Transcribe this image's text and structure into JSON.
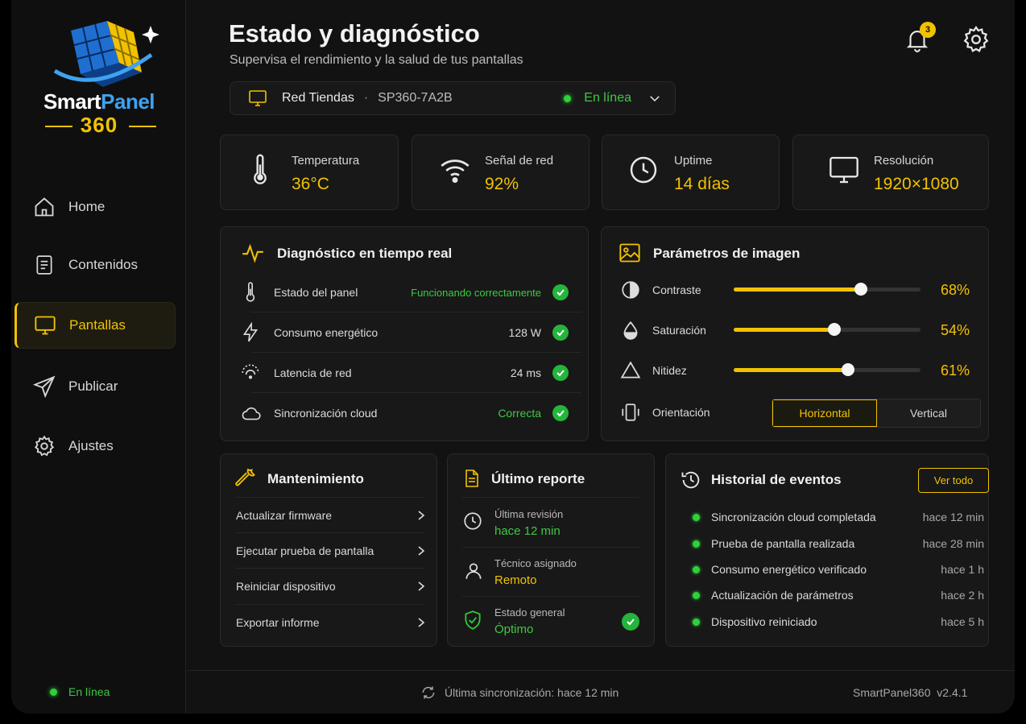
{
  "brand": {
    "name_a": "Smart",
    "name_b": "Panel",
    "name_num": "360"
  },
  "nav": [
    {
      "label": "Home",
      "icon": "home-icon"
    },
    {
      "label": "Contenidos",
      "icon": "document-icon"
    },
    {
      "label": "Pantallas",
      "icon": "monitor-icon",
      "active": true
    },
    {
      "label": "Publicar",
      "icon": "send-icon"
    },
    {
      "label": "Ajustes",
      "icon": "gear-icon"
    }
  ],
  "sidebar_status": "En línea",
  "header": {
    "title": "Estado y diagnóstico",
    "subtitle": "Supervisa el rendimiento y la salud de tus pantallas",
    "notifications": "3"
  },
  "device": {
    "name": "Red Tiendas",
    "separator": "·",
    "id": "SP360-7A2B",
    "status": "En línea"
  },
  "stats": [
    {
      "label": "Temperatura",
      "value": "36°C",
      "icon": "thermometer-icon"
    },
    {
      "label": "Señal de red",
      "value": "92%",
      "icon": "wifi-icon"
    },
    {
      "label": "Uptime",
      "value": "14 días",
      "icon": "clock-icon"
    },
    {
      "label": "Resolución",
      "value": "1920×1080",
      "icon": "monitor-icon"
    }
  ],
  "diagnostics": {
    "title": "Diagnóstico en tiempo real",
    "rows": [
      {
        "label": "Estado del panel",
        "value": "Funcionando correctamente"
      },
      {
        "label": "Consumo energético",
        "value": "128 W"
      },
      {
        "label": "Latencia de red",
        "value": "24 ms"
      },
      {
        "label": "Sincronización cloud",
        "value": "Correcta"
      }
    ]
  },
  "image_params": {
    "title": "Parámetros de imagen",
    "sliders": [
      {
        "label": "Contraste",
        "value": 68,
        "display": "68%"
      },
      {
        "label": "Saturación",
        "value": 54,
        "display": "54%"
      },
      {
        "label": "Nitidez",
        "value": 61,
        "display": "61%"
      }
    ],
    "orientation_label": "Orientación",
    "orientation_options": [
      "Horizontal",
      "Vertical"
    ],
    "orientation_selected": "Horizontal"
  },
  "maintenance": {
    "title": "Mantenimiento",
    "items": [
      "Actualizar firmware",
      "Ejecutar prueba de pantalla",
      "Reiniciar dispositivo",
      "Exportar informe"
    ]
  },
  "report": {
    "title": "Último reporte",
    "items": [
      {
        "label": "Última revisión",
        "value": "hace 12 min"
      },
      {
        "label": "Técnico asignado",
        "value": "Remoto"
      },
      {
        "label": "Estado general",
        "value": "Óptimo"
      }
    ]
  },
  "events": {
    "title": "Historial de eventos",
    "view_all": "Ver todo",
    "items": [
      {
        "label": "Sincronización cloud completada",
        "time": "hace 12 min"
      },
      {
        "label": "Prueba de pantalla realizada",
        "time": "hace 28 min"
      },
      {
        "label": "Consumo energético verificado",
        "time": "hace 1 h"
      },
      {
        "label": "Actualización de parámetros",
        "time": "hace 2 h"
      },
      {
        "label": "Dispositivo reiniciado",
        "time": "hace 5 h"
      }
    ]
  },
  "footer": {
    "sync": "Última sincronización: hace 12 min",
    "app": "SmartPanel360",
    "version": "v2.4.1"
  },
  "colors": {
    "accent": "#f2c200",
    "ok": "#25b43c",
    "bg": "#121212"
  }
}
